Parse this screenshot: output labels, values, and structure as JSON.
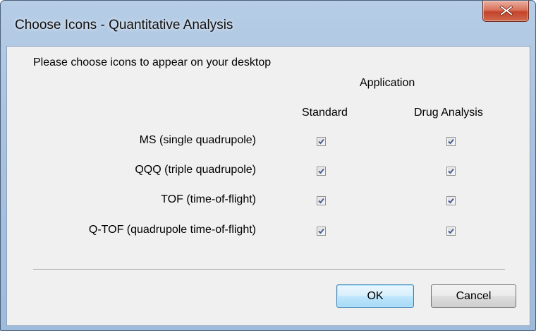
{
  "window": {
    "title": "Choose Icons - Quantitative Analysis",
    "close_icon": "close-x"
  },
  "dialog": {
    "instruction": "Please choose icons to appear on your desktop",
    "group_header": "Application",
    "columns": [
      "Standard",
      "Drug Analysis"
    ],
    "rows": [
      {
        "label": "MS (single quadrupole)",
        "standard": true,
        "drug_analysis": true
      },
      {
        "label": "QQQ (triple quadrupole)",
        "standard": true,
        "drug_analysis": true
      },
      {
        "label": "TOF (time-of-flight)",
        "standard": true,
        "drug_analysis": true
      },
      {
        "label": "Q-TOF (quadrupole time-of-flight)",
        "standard": true,
        "drug_analysis": true
      }
    ]
  },
  "buttons": {
    "ok": "OK",
    "cancel": "Cancel"
  },
  "colors": {
    "frame": "#a9c2df",
    "close_button": "#c4432a",
    "client_background": "#f0f0f0",
    "default_button_border": "#3c7fb1",
    "check_mark": "#4a5f97"
  }
}
